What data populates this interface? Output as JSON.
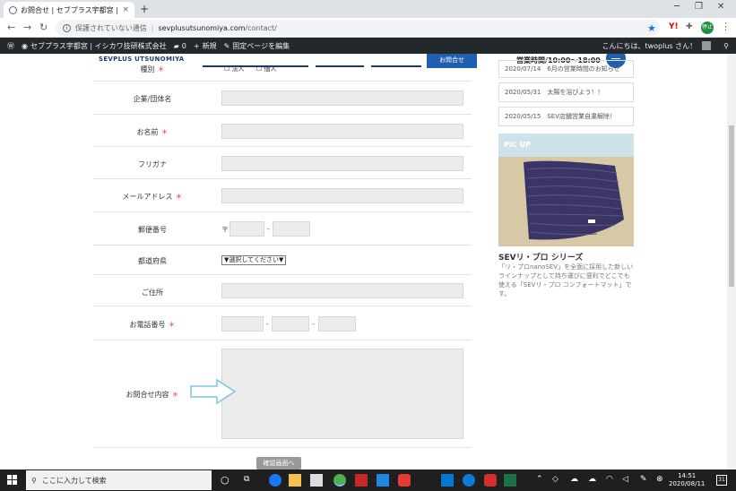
{
  "browser": {
    "tab_title": "お問合せ | セブプラス宇都宮 | イシカ",
    "tab_close": "×",
    "new_tab": "+",
    "security_label": "保護されていない通信",
    "url_host": "sevplusutsunomiya.com",
    "url_path": "/contact/",
    "profile_initials": "停止"
  },
  "wp_admin": {
    "site_name": "セブプラス宇都宮 | イシカワ技研株式会社",
    "comments_count": "0",
    "new_label": "新規",
    "edit_label": "固定ページを編集",
    "greeting": "こんにちは、twoplus さん！"
  },
  "site_header": {
    "brand": "SEVPLUS UTSUNOMIYA",
    "nav_button": "お問合せ",
    "hours": "営業時間/10:00〜18:00"
  },
  "form": {
    "type_row": {
      "label": "種別",
      "options": [
        "法人",
        "個人"
      ]
    },
    "company": {
      "label": "企業/団体名"
    },
    "name": {
      "label": "お名前",
      "required": "＊"
    },
    "furigana": {
      "label": "フリガナ"
    },
    "email": {
      "label": "メールアドレス",
      "required": "＊"
    },
    "zip": {
      "label": "郵便番号",
      "prefix": "〒",
      "sep": "-"
    },
    "pref": {
      "label": "都道府県",
      "selected": "▼選択してください▼"
    },
    "address": {
      "label": "ご住所"
    },
    "phone": {
      "label": "お電話番号",
      "required": "＊",
      "sep": "-"
    },
    "message": {
      "label": "お問合せ内容",
      "required": "＊"
    },
    "submit": "確認画面へ"
  },
  "sidebar": {
    "news": [
      "2020/07/14　6月の営業時間のお知らせ",
      "2020/05/31　太陽を浴びよう！！",
      "2020/05/15　SEV店舗営業自粛解除！"
    ],
    "pickup_title": "PIC UP",
    "product_title": "SEVリ・プロ シリーズ",
    "product_desc": "「リ・プロnanoSEV」を全面に採用した新しいラインナップとして持ち運びに便利でどこでも使える「SEVリ・プロ コンフォートマット」です。"
  },
  "taskbar": {
    "search_placeholder": "ここに入力して検索",
    "time": "14:51",
    "date": "2020/08/11",
    "notif_count": "31"
  }
}
